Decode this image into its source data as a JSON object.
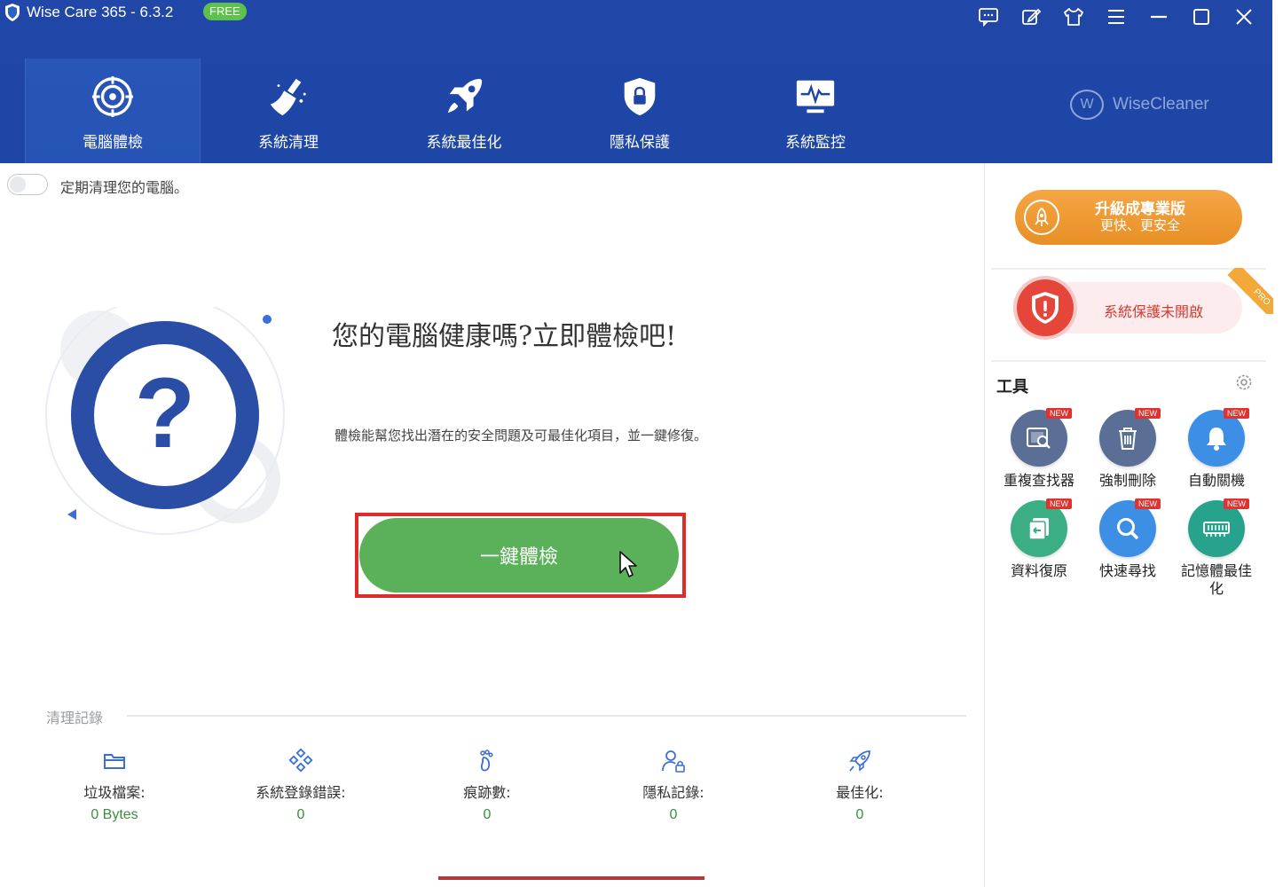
{
  "titlebar": {
    "title": "Wise Care 365 - 6.3.2",
    "badge": "FREE",
    "icons": [
      "feedback-icon",
      "edit-icon",
      "skin-icon",
      "menu-icon",
      "minimize-icon",
      "maximize-icon",
      "close-icon"
    ]
  },
  "nav": {
    "items": [
      {
        "label": "電腦體檢",
        "icon": "target-icon",
        "active": true
      },
      {
        "label": "系統清理",
        "icon": "broom-icon",
        "active": false
      },
      {
        "label": "系統最佳化",
        "icon": "rocket-icon",
        "active": false
      },
      {
        "label": "隱私保護",
        "icon": "privacy-shield-icon",
        "active": false
      },
      {
        "label": "系統監控",
        "icon": "monitor-icon",
        "active": false
      }
    ],
    "brand": "WiseCleaner",
    "brand_logo": "W"
  },
  "main": {
    "schedule_label": "定期清理您的電腦。",
    "title": "您的電腦健康嗎?立即體檢吧!",
    "description": "體檢能幫您找出潛在的安全問題及可最佳化項目，並一鍵修復。",
    "check_button": "一鍵體檢",
    "records_title": "清理記錄",
    "records": [
      {
        "label": "垃圾檔案:",
        "value": "0 Bytes",
        "icon": "folder-icon"
      },
      {
        "label": "系統登錄錯誤:",
        "value": "0",
        "icon": "registry-icon"
      },
      {
        "label": "痕跡數:",
        "value": "0",
        "icon": "footprint-icon"
      },
      {
        "label": "隱私記錄:",
        "value": "0",
        "icon": "user-lock-icon"
      },
      {
        "label": "最佳化:",
        "value": "0",
        "icon": "rocket-icon"
      }
    ]
  },
  "sidebar": {
    "upgrade_line1": "升級成專業版",
    "upgrade_line2": "更快、更安全",
    "protection_status": "系統保護未開啟",
    "pro_badge": "PRO",
    "tools_title": "工具",
    "new_badge": "NEW",
    "tools": [
      {
        "label": "重複查找器",
        "icon": "duplicate-finder-icon",
        "color": "#5a6e96"
      },
      {
        "label": "強制刪除",
        "icon": "trash-icon",
        "color": "#5a6e96"
      },
      {
        "label": "自動關機",
        "icon": "bell-icon",
        "color": "#3d8fe6"
      },
      {
        "label": "資料復原",
        "icon": "data-recovery-icon",
        "color": "#3cae84"
      },
      {
        "label": "快速尋找",
        "icon": "search-icon",
        "color": "#3d8fe6"
      },
      {
        "label": "記憶體最佳化",
        "icon": "memory-icon",
        "color": "#27a38d"
      }
    ]
  },
  "colors": {
    "header": "#1d46a6",
    "check_button": "#5bb15a",
    "highlight_frame": "#e02b2b",
    "upgrade": "#ee9a31",
    "protect_red": "#e6463a"
  }
}
